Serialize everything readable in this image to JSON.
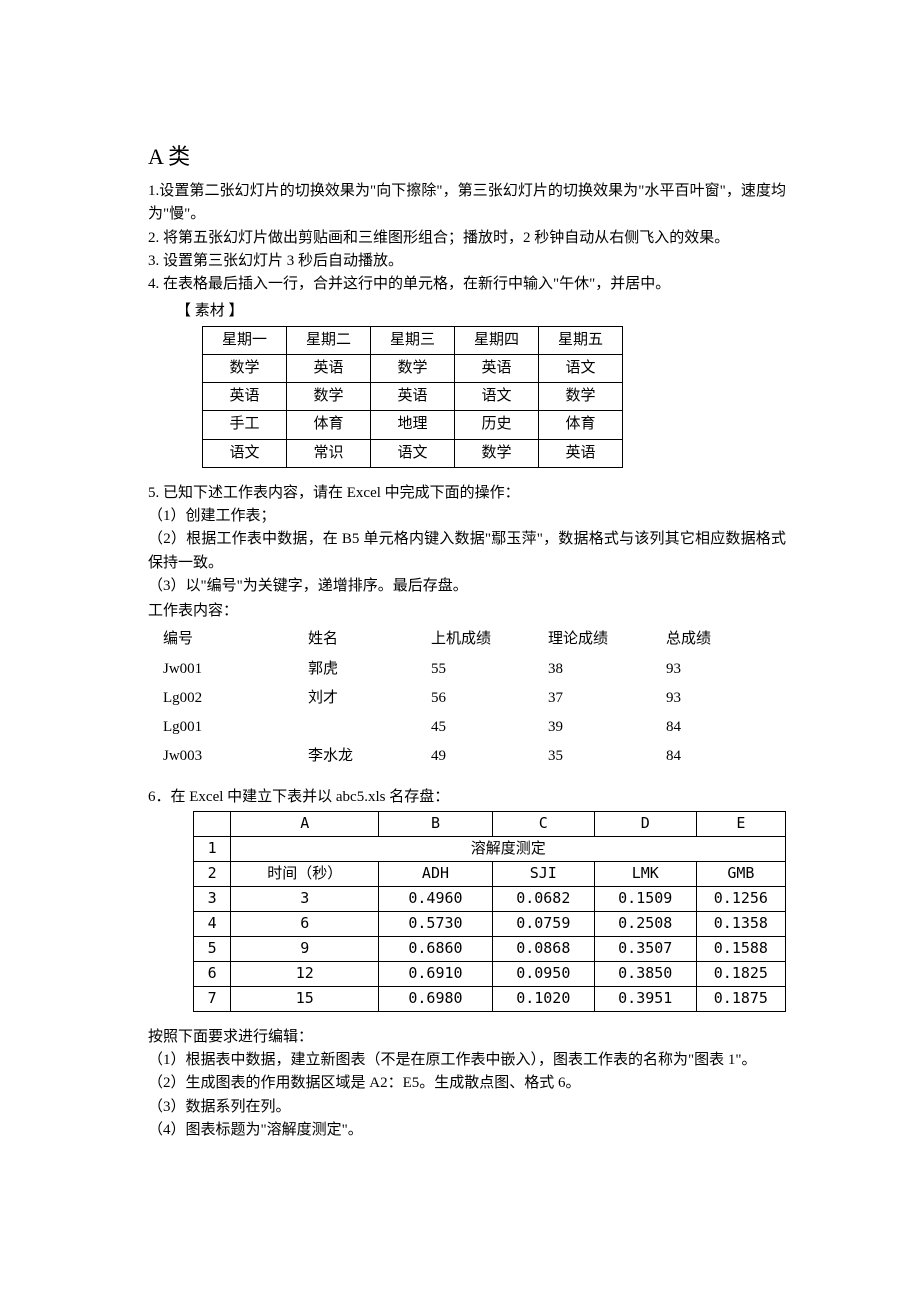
{
  "heading": "A 类",
  "items": {
    "i1": "1.设置第二张幻灯片的切换效果为\"向下擦除\"，第三张幻灯片的切换效果为\"水平百叶窗\"，速度均为\"慢\"。",
    "i2": "2. 将第五张幻灯片做出剪贴画和三维图形组合；播放时，2 秒钟自动从右侧飞入的效果。",
    "i3": "3. 设置第三张幻灯片 3 秒后自动播放。",
    "i4": "4. 在表格最后插入一行，合并这行中的单元格，在新行中输入\"午休\"，并居中。"
  },
  "material_label": "【 素材 】",
  "schedule": {
    "r1": [
      "星期一",
      "星期二",
      "星期三",
      "星期四",
      "星期五"
    ],
    "r2": [
      "数学",
      "英语",
      "数学",
      "英语",
      "语文"
    ],
    "r3": [
      "英语",
      "数学",
      "英语",
      "语文",
      "数学"
    ],
    "r4": [
      "手工",
      "体育",
      "地理",
      "历史",
      "体育"
    ],
    "r5": [
      "语文",
      "常识",
      "语文",
      "数学",
      "英语"
    ]
  },
  "q5": {
    "lead": "5. 已知下述工作表内容，请在 Excel 中完成下面的操作：",
    "s1": "（1）创建工作表；",
    "s2": "（2）根据工作表中数据，在 B5 单元格内键入数据\"鄢玉萍\"，数据格式与该列其它相应数据格式保持一致。",
    "s3": "（3）以\"编号\"为关键字，递增排序。最后存盘。",
    "wlabel": "工作表内容："
  },
  "scores": {
    "h": [
      "编号",
      "姓名",
      "上机成绩",
      "理论成绩",
      "总成绩"
    ],
    "r1": [
      "Jw001",
      "郭虎",
      "55",
      "38",
      "93"
    ],
    "r2": [
      "Lg002",
      "刘才",
      "56",
      "37",
      "93"
    ],
    "r3": [
      "Lg001",
      "",
      "45",
      "39",
      "84"
    ],
    "r4": [
      "Jw003",
      "李水龙",
      "49",
      "35",
      "84"
    ]
  },
  "q6": {
    "lead": "6．在 Excel 中建立下表并以 abc5.xls 名存盘：",
    "edit_lead": " 按照下面要求进行编辑：",
    "s1": "（1）根据表中数据，建立新图表（不是在原工作表中嵌入），图表工作表的名称为\"图表 1\"。",
    "s2": "（2）生成图表的作用数据区域是 A2：E5。生成散点图、格式 6。",
    "s3": "（3）数据系列在列。",
    "s4": "（4）图表标题为\"溶解度测定\"。"
  },
  "solub": {
    "colheads": [
      "",
      "A",
      "B",
      "C",
      "D",
      "E"
    ],
    "mergerow_label": "1",
    "mergerow_val": "溶解度测定",
    "r2": [
      "2",
      "时间（秒）",
      "ADH",
      "SJI",
      "LMK",
      "GMB"
    ],
    "r3": [
      "3",
      "3",
      "0.4960",
      "0.0682",
      "0.1509",
      "0.1256"
    ],
    "r4": [
      "4",
      "6",
      "0.5730",
      "0.0759",
      "0.2508",
      "0.1358"
    ],
    "r5": [
      "5",
      "9",
      "0.6860",
      "0.0868",
      "0.3507",
      "0.1588"
    ],
    "r6": [
      "6",
      "12",
      "0.6910",
      "0.0950",
      "0.3850",
      "0.1825"
    ],
    "r7": [
      "7",
      "15",
      "0.6980",
      "0.1020",
      "0.3951",
      "0.1875"
    ]
  }
}
